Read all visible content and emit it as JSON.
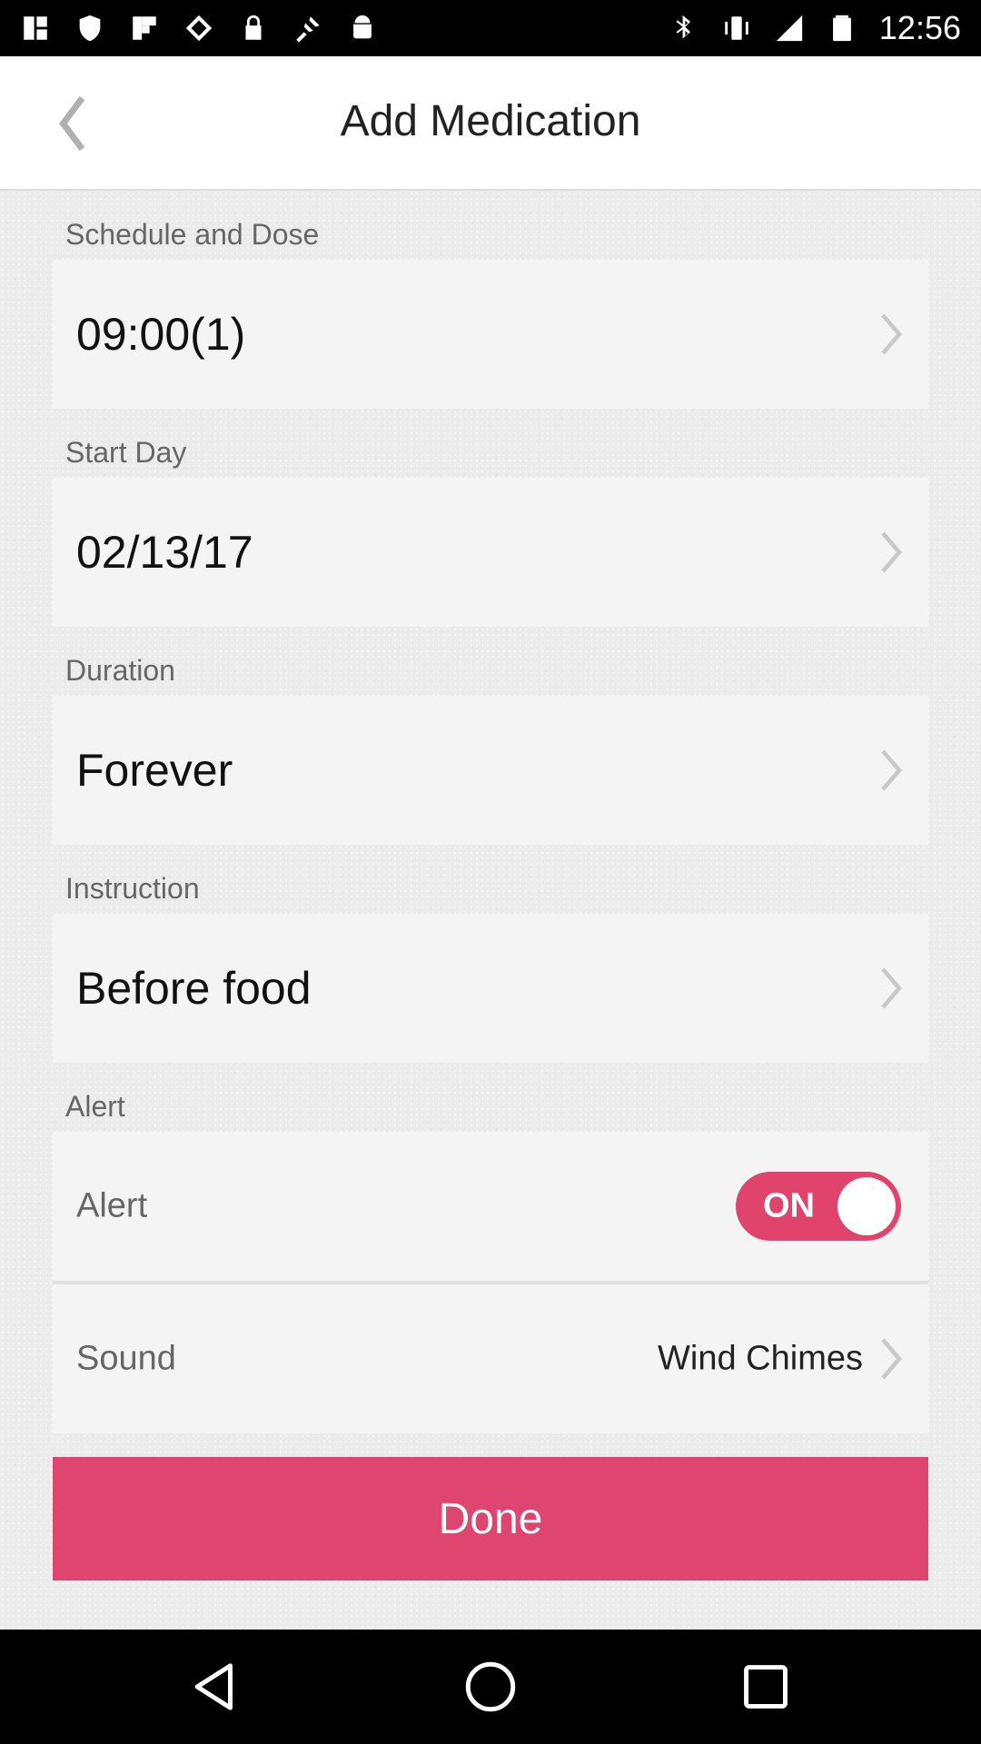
{
  "status_bar": {
    "time": "12:56",
    "left_icons": [
      "notification-icon",
      "shield-icon",
      "flipboard-icon",
      "gesture-icon",
      "lock-icon",
      "fake-gps-icon",
      "android-icon"
    ],
    "right_icons": [
      "bluetooth-icon",
      "vibrate-icon",
      "signal-icon",
      "battery-icon"
    ]
  },
  "header": {
    "title": "Add Medication",
    "back_icon": "chevron-left-icon"
  },
  "sections": {
    "schedule": {
      "label": "Schedule and Dose",
      "value": "09:00(1)"
    },
    "start_day": {
      "label": "Start Day",
      "value": "02/13/17"
    },
    "duration": {
      "label": "Duration",
      "value": "Forever"
    },
    "instruction": {
      "label": "Instruction",
      "value": "Before food"
    },
    "alert": {
      "label": "Alert",
      "alert_row_label": "Alert",
      "toggle_text": "ON",
      "toggle_on": true,
      "sound_label": "Sound",
      "sound_value": "Wind Chimes"
    }
  },
  "done_button": {
    "label": "Done"
  },
  "colors": {
    "accent": "#de4670",
    "toggle": "#e0436c"
  },
  "nav_bar": {
    "icons": [
      "back-triangle-icon",
      "home-circle-icon",
      "recents-square-icon"
    ]
  }
}
